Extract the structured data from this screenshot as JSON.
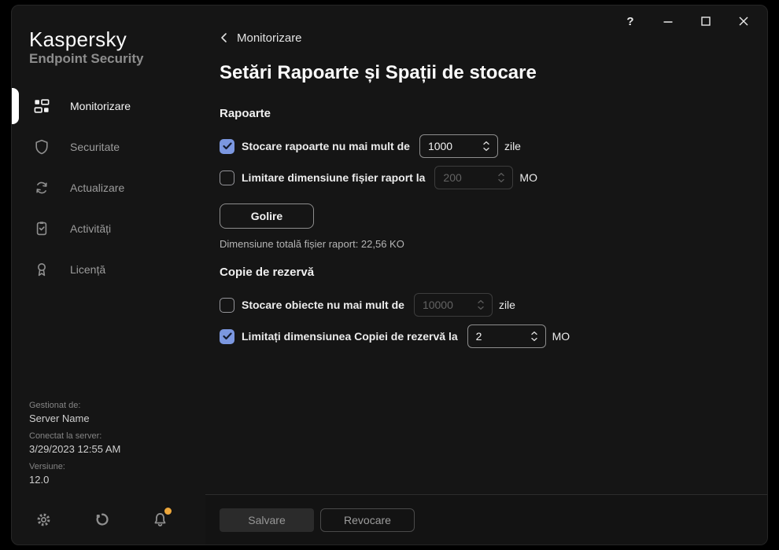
{
  "titlebar": {
    "help_label": "?"
  },
  "sidebar": {
    "brand_name": "Kaspersky",
    "brand_subtitle": "Endpoint Security",
    "items": [
      {
        "label": "Monitorizare",
        "active": true
      },
      {
        "label": "Securitate",
        "active": false
      },
      {
        "label": "Actualizare",
        "active": false
      },
      {
        "label": "Activități",
        "active": false
      },
      {
        "label": "Licență",
        "active": false
      }
    ],
    "info": {
      "managed_label": "Gestionat de:",
      "managed_value": "Server Name",
      "connected_label": "Conectat la server:",
      "connected_value": "3/29/2023 12:55 AM",
      "version_label": "Versiune:",
      "version_value": "12.0"
    }
  },
  "main": {
    "back_label": "Monitorizare",
    "page_title": "Setări Rapoarte și Spații de stocare",
    "reports": {
      "heading": "Rapoarte",
      "row_store": {
        "label": "Stocare rapoarte nu mai mult de",
        "value": "1000",
        "unit": "zile",
        "checked": true,
        "enabled": true
      },
      "row_limit": {
        "label": "Limitare dimensiune fișier raport la",
        "value": "200",
        "unit": "MO",
        "checked": false,
        "enabled": false
      },
      "clear_button": "Golire",
      "total_note": "Dimensiune totală fișier raport: 22,56 KO"
    },
    "backup": {
      "heading": "Copie de rezervă",
      "row_store": {
        "label": "Stocare obiecte nu mai mult de",
        "value": "10000",
        "unit": "zile",
        "checked": false,
        "enabled": false
      },
      "row_limit": {
        "label": "Limitați dimensiunea Copiei de rezervă la",
        "value": "2",
        "unit": "MO",
        "checked": true,
        "enabled": true
      }
    },
    "footer": {
      "save_label": "Salvare",
      "cancel_label": "Revocare"
    }
  },
  "colors": {
    "checkbox_checked": "#7b97e0",
    "notification_dot": "#eda73b",
    "window_background": "#151515"
  }
}
